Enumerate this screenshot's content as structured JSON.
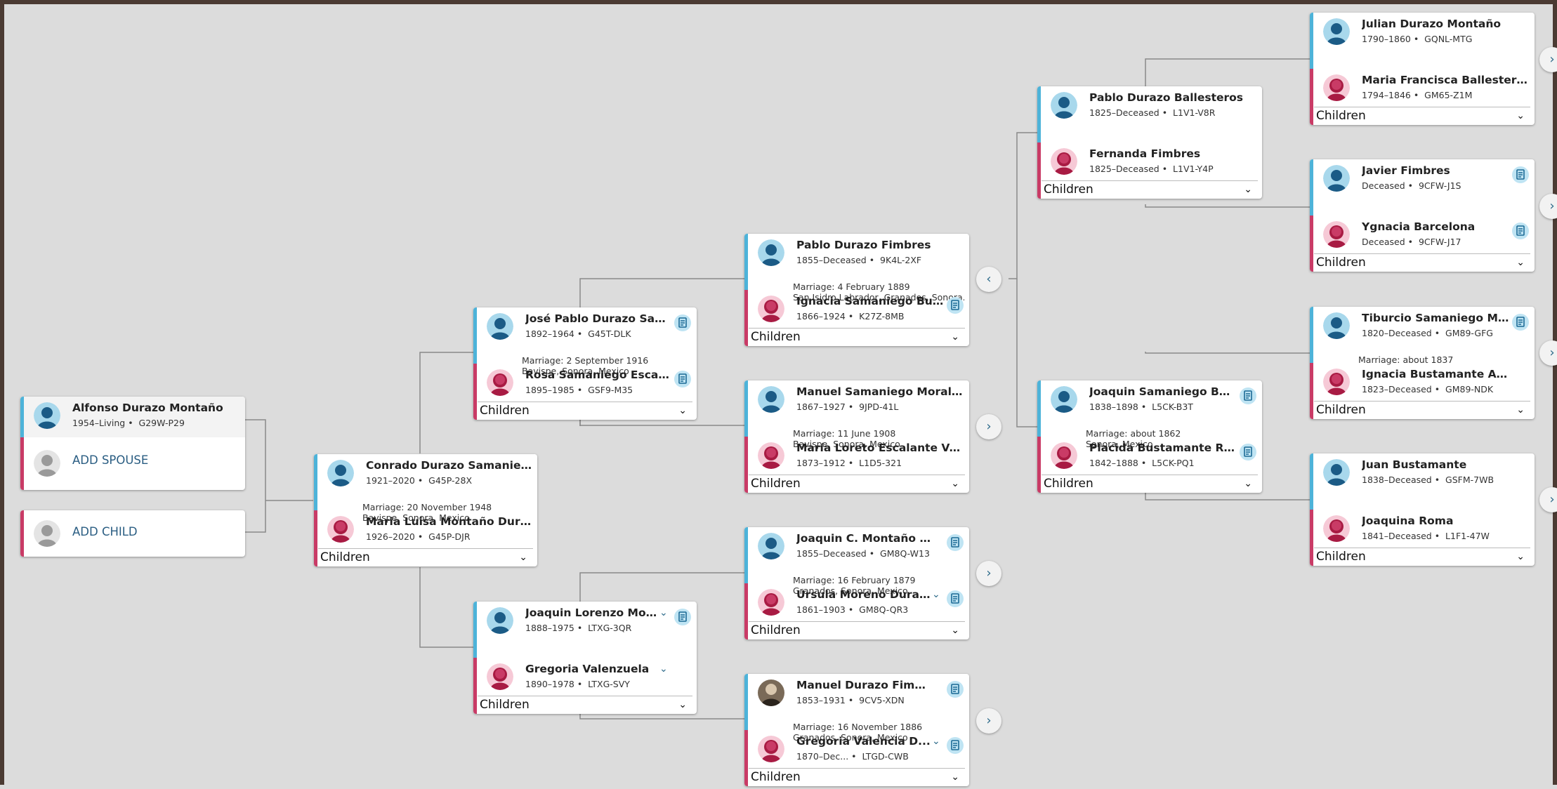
{
  "focus": {
    "person": {
      "name": "Alfonso Durazo Montaño",
      "vitals": "1954–Living",
      "pid": "G29W-P29"
    },
    "add_spouse": "ADD SPOUSE",
    "add_child": "ADD CHILD"
  },
  "children_label": "Children",
  "couples": {
    "c1": {
      "husband": {
        "name": "Conrado Durazo Samaniego",
        "vitals": "1921–2020",
        "pid": "G45P-28X"
      },
      "marriage": [
        "Marriage: 20 November 1948",
        "Bavispe, Sonora, Mexico"
      ],
      "wife": {
        "name": "Maria Luisa Montaño Durazo",
        "vitals": "1926–2020",
        "pid": "G45P-DJR"
      }
    },
    "c2": {
      "husband": {
        "name": "José Pablo Durazo Saman...",
        "vitals": "1892–1964",
        "pid": "G45T-DLK"
      },
      "marriage": [
        "Marriage: 2 September 1916",
        "Bavispe, Sonora, Mexico"
      ],
      "wife": {
        "name": "Rosa Samaniego Escalante",
        "vitals": "1895–1985",
        "pid": "GSF9-M35"
      }
    },
    "c3": {
      "husband": {
        "name": "Joaquin Lorenzo Mo...",
        "vitals": "1888–1975",
        "pid": "LTXG-3QR"
      },
      "wife": {
        "name": "Gregoria Valenzuela",
        "vitals": "1890–1978",
        "pid": "LTXG-SVY"
      }
    },
    "c4": {
      "husband": {
        "name": "Pablo Durazo Fimbres",
        "vitals": "1855–Deceased",
        "pid": "9K4L-2XF"
      },
      "marriage": [
        "Marriage: 4 February 1889",
        "San Isidro Labrador, Granados, Sonora..."
      ],
      "wife": {
        "name": "Ignacia Samaniego Busta...",
        "vitals": "1866–1924",
        "pid": "K27Z-8MB"
      }
    },
    "c5": {
      "husband": {
        "name": "Manuel Samaniego Morales",
        "vitals": "1867–1927",
        "pid": "9JPD-41L"
      },
      "marriage": [
        "Marriage: 11 June 1908",
        "Bavispe, Sonora, Mexico"
      ],
      "wife": {
        "name": "María Loreto Escalante Valen...",
        "vitals": "1873–1912",
        "pid": "L1D5-321"
      }
    },
    "c6": {
      "husband": {
        "name": "Joaquin C. Montaño Garcia",
        "vitals": "1855–Deceased",
        "pid": "GM8Q-W13"
      },
      "marriage": [
        "Marriage: 16 February 1879",
        "Granados, Sonora, Mexico"
      ],
      "wife": {
        "name": "Ursula Moreno Dura...",
        "vitals": "1861–1903",
        "pid": "GM8Q-QR3"
      }
    },
    "c7": {
      "husband": {
        "name": "Manuel Durazo Fimbres",
        "vitals": "1853–1931",
        "pid": "9CV5-XDN"
      },
      "marriage": [
        "Marriage: 16 November 1886",
        "Granados, Sonora, Mexico"
      ],
      "wife": {
        "name": "Gregoria Valencia D...",
        "vitals": "1870–Dec...",
        "pid": "LTGD-CWB"
      }
    },
    "c8": {
      "husband": {
        "name": "Pablo Durazo Ballesteros",
        "vitals": "1825–Deceased",
        "pid": "L1V1-V8R"
      },
      "wife": {
        "name": "Fernanda Fimbres",
        "vitals": "1825–Deceased",
        "pid": "L1V1-Y4P"
      }
    },
    "c9": {
      "husband": {
        "name": "Joaquin Samaniego Busta...",
        "vitals": "1838–1898",
        "pid": "L5CK-B3T"
      },
      "marriage": [
        "Marriage: about 1862",
        "Sonora, Mexico"
      ],
      "wife": {
        "name": "Placida Bustamante Romo",
        "vitals": "1842–1888",
        "pid": "L5CK-PQ1"
      }
    },
    "c10": {
      "husband": {
        "name": "Julian Durazo Montaño",
        "vitals": "1790–1860",
        "pid": "GQNL-MTG"
      },
      "wife": {
        "name": "Maria Francisca Ballesteros",
        "vitals": "1794–1846",
        "pid": "GM65-Z1M"
      }
    },
    "c11": {
      "husband": {
        "name": "Javier Fimbres",
        "vitals": "Deceased",
        "pid": "9CFW-J1S"
      },
      "wife": {
        "name": "Ygnacia Barcelona",
        "vitals": "Deceased",
        "pid": "9CFW-J17"
      }
    },
    "c12": {
      "husband": {
        "name": "Tiburcio Samaniego Moreno",
        "vitals": "1820–Deceased",
        "pid": "GM89-GFG"
      },
      "marriage": [
        "Marriage: about 1837"
      ],
      "wife": {
        "name": "Ignacia Bustamante Arvizu",
        "vitals": "1823–Deceased",
        "pid": "GM89-NDK"
      }
    },
    "c13": {
      "husband": {
        "name": "Juan Bustamante",
        "vitals": "1838–Deceased",
        "pid": "GSFM-7WB"
      },
      "wife": {
        "name": "Joaquina Roma",
        "vitals": "1841–Deceased",
        "pid": "L1F1-47W"
      }
    }
  },
  "icons": {
    "nav_back": "chevron-left-icon",
    "nav_forward": "chevron-right-icon",
    "source": "record-source-icon",
    "dropdown": "chevron-down-icon"
  },
  "colors": {
    "male": "#4db3d9",
    "female": "#c93b66",
    "link": "#2a5d82",
    "background": "#dcdcdc"
  }
}
